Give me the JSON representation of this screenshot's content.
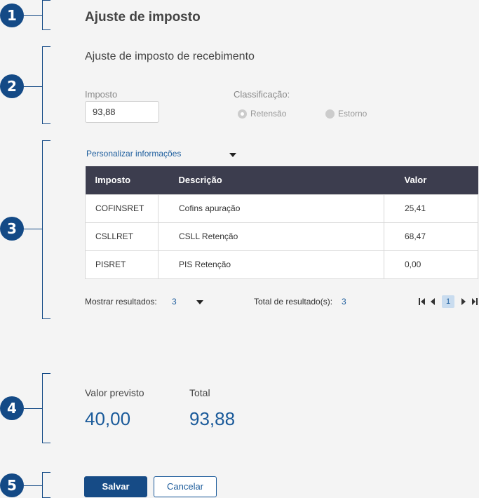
{
  "callouts": [
    "1",
    "2",
    "3",
    "4",
    "5"
  ],
  "page_title": "Ajuste de imposto",
  "section_title": "Ajuste de imposto de recebimento",
  "form": {
    "imposto_label": "Imposto",
    "imposto_value": "93,88",
    "classificacao_label": "Classificação:",
    "options": [
      {
        "label": "Retensão",
        "selected": true
      },
      {
        "label": "Estorno",
        "selected": false
      }
    ]
  },
  "customize_label": "Personalizar informações",
  "table": {
    "headers": [
      "Imposto",
      "Descrição",
      "Valor"
    ],
    "rows": [
      [
        "COFINSRET",
        "Cofins apuração",
        "25,41"
      ],
      [
        "CSLLRET",
        "CSLL Retenção",
        "68,47"
      ],
      [
        "PISRET",
        "PIS Retenção",
        "0,00"
      ]
    ]
  },
  "pager": {
    "show_label": "Mostrar resultados:",
    "show_value": "3",
    "total_label": "Total de resultado(s):",
    "total_value": "3",
    "current_page": "1"
  },
  "summary": {
    "previsto_label": "Valor previsto",
    "previsto_value": "40,00",
    "total_label": "Total",
    "total_value": "93,88"
  },
  "buttons": {
    "save": "Salvar",
    "cancel": "Cancelar"
  },
  "colors": {
    "accent": "#144a86",
    "table_header": "#3c3d4e"
  }
}
